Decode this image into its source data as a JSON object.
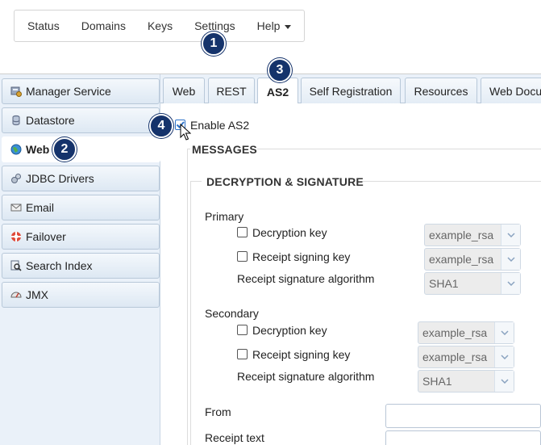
{
  "menu": {
    "items": [
      "Status",
      "Domains",
      "Keys",
      "Settings",
      "Help"
    ]
  },
  "badges": [
    "1",
    "2",
    "3",
    "4"
  ],
  "sidebar": {
    "items": [
      {
        "label": "Manager Service",
        "icon": "manager-service-icon"
      },
      {
        "label": "Datastore",
        "icon": "datastore-icon"
      },
      {
        "label": "Web",
        "icon": "globe-icon",
        "active": true
      },
      {
        "label": "JDBC Drivers",
        "icon": "jdbc-icon"
      },
      {
        "label": "Email",
        "icon": "email-icon"
      },
      {
        "label": "Failover",
        "icon": "lifebuoy-icon"
      },
      {
        "label": "Search Index",
        "icon": "search-index-icon"
      },
      {
        "label": "JMX",
        "icon": "gauge-icon"
      }
    ]
  },
  "tabs": [
    "Web",
    "REST",
    "AS2",
    "Self Registration",
    "Resources",
    "Web Docu"
  ],
  "active_tab": "AS2",
  "content": {
    "enable_label": "Enable AS2",
    "enable_checked": true,
    "messages_title": "MESSAGES",
    "decryption_title": "DECRYPTION & SIGNATURE",
    "primary": {
      "label": "Primary",
      "decryption_key_label": "Decryption key",
      "decryption_key_value": "example_rsa",
      "receipt_signing_label": "Receipt signing key",
      "receipt_signing_value": "example_rsa",
      "algorithm_label": "Receipt signature algorithm",
      "algorithm_value": "SHA1"
    },
    "secondary": {
      "label": "Secondary",
      "decryption_key_label": "Decryption key",
      "decryption_key_value": "example_rsa",
      "receipt_signing_label": "Receipt signing key",
      "receipt_signing_value": "example_rsa",
      "algorithm_label": "Receipt signature algorithm",
      "algorithm_value": "SHA1"
    },
    "from_label": "From",
    "receipt_text_label": "Receipt text"
  },
  "colors": {
    "badge": "#15336b",
    "sidebar_bg": "#eaf1f9",
    "checkbox_accent": "#2f73c9"
  }
}
